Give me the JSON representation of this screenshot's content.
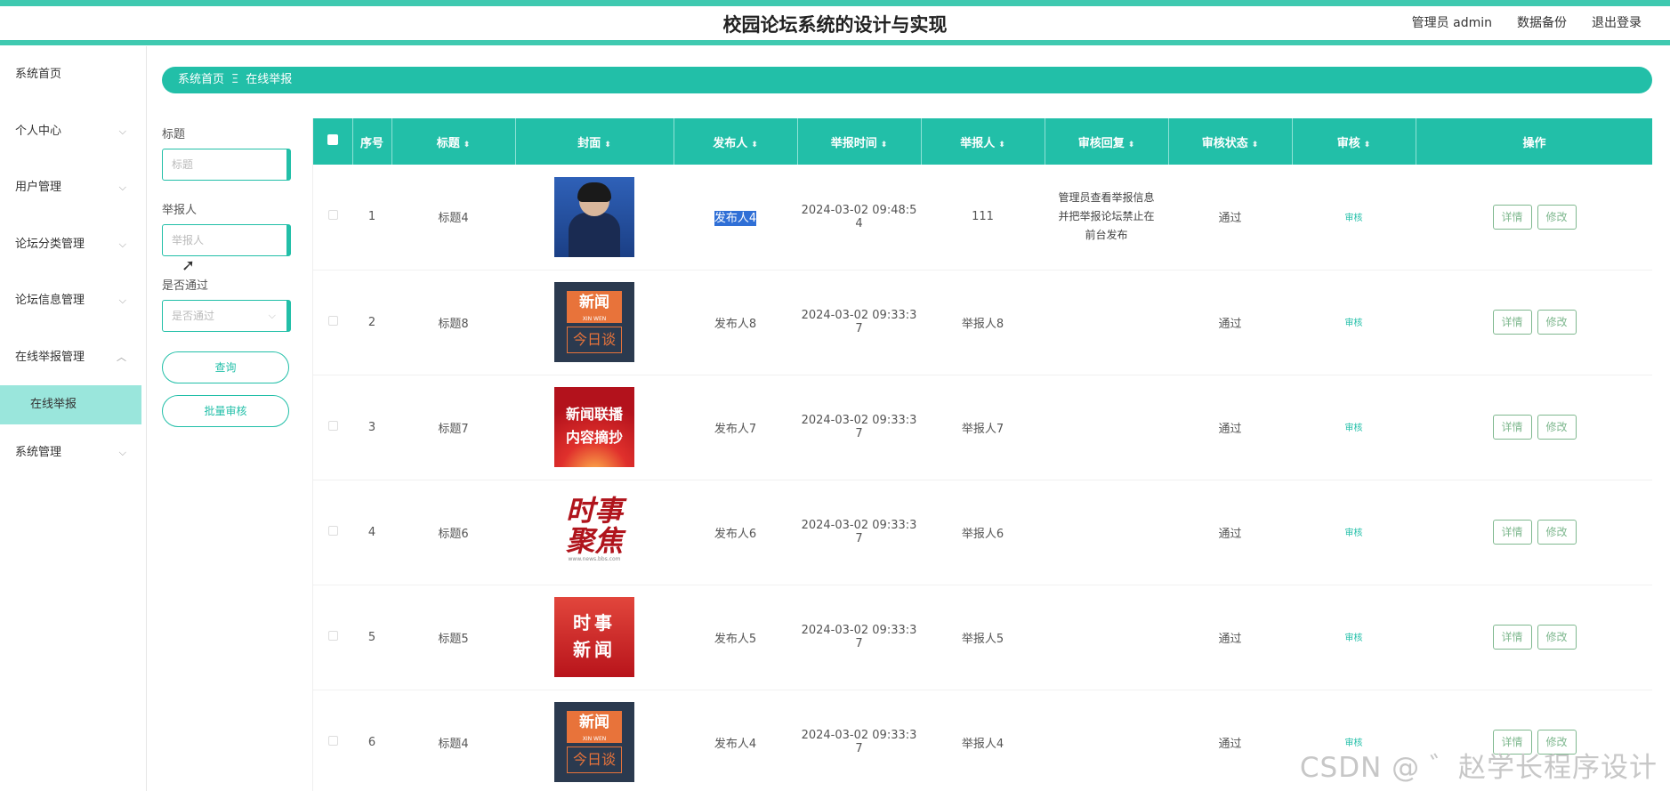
{
  "header": {
    "title": "校园论坛系统的设计与实现",
    "admin_label": "管理员 admin",
    "backup_label": "数据备份",
    "logout_label": "退出登录"
  },
  "sidebar": {
    "items": [
      {
        "label": "系统首页"
      },
      {
        "label": "个人中心",
        "chev": "⌵"
      },
      {
        "label": "用户管理",
        "chev": "⌵"
      },
      {
        "label": "论坛分类管理",
        "chev": "⌵"
      },
      {
        "label": "论坛信息管理",
        "chev": "⌵"
      },
      {
        "label": "在线举报管理",
        "chev": "︿"
      },
      {
        "label": "系统管理",
        "chev": "⌵"
      }
    ],
    "active_sub": "在线举报"
  },
  "breadcrumb": {
    "home": "系统首页",
    "sep": "Ξ",
    "current": "在线举报"
  },
  "filter": {
    "title_label": "标题",
    "title_placeholder": "标题",
    "reporter_label": "举报人",
    "reporter_placeholder": "举报人",
    "passed_label": "是否通过",
    "passed_placeholder": "是否通过",
    "query_button": "查询",
    "batch_button": "批量审核"
  },
  "table": {
    "headers": {
      "index": "序号",
      "title": "标题",
      "cover": "封面",
      "publisher": "发布人",
      "report_time": "举报时间",
      "reporter": "举报人",
      "reply": "审核回复",
      "status": "审核状态",
      "audit": "审核",
      "ops": "操作"
    },
    "sort_icon": "⬍",
    "audit_label": "审核",
    "detail_label": "详情",
    "edit_label": "修改",
    "rows": [
      {
        "index": "1",
        "title": "标题4",
        "cover": "news1",
        "publisher": "发布人4",
        "time1": "2024-03-02 09:48:5",
        "time2": "4",
        "reporter": "111",
        "reply": "管理员查看举报信息并把举报论坛禁止在前台发布",
        "status": "通过"
      },
      {
        "index": "2",
        "title": "标题8",
        "cover": "xinwen",
        "publisher": "发布人8",
        "time1": "2024-03-02 09:33:3",
        "time2": "7",
        "reporter": "举报人8",
        "reply": "",
        "status": "通过"
      },
      {
        "index": "3",
        "title": "标题7",
        "cover": "lianbo",
        "publisher": "发布人7",
        "time1": "2024-03-02 09:33:3",
        "time2": "7",
        "reporter": "举报人7",
        "reply": "",
        "status": "通过"
      },
      {
        "index": "4",
        "title": "标题6",
        "cover": "shishi1",
        "publisher": "发布人6",
        "time1": "2024-03-02 09:33:3",
        "time2": "7",
        "reporter": "举报人6",
        "reply": "",
        "status": "通过"
      },
      {
        "index": "5",
        "title": "标题5",
        "cover": "shishi2",
        "publisher": "发布人5",
        "time1": "2024-03-02 09:33:3",
        "time2": "7",
        "reporter": "举报人5",
        "reply": "",
        "status": "通过"
      },
      {
        "index": "6",
        "title": "标题4",
        "cover": "xinwen",
        "publisher": "发布人4",
        "time1": "2024-03-02 09:33:3",
        "time2": "7",
        "reporter": "举报人4",
        "reply": "",
        "status": "通过"
      }
    ]
  },
  "covers": {
    "xinwen_top": "新闻",
    "xinwen_small": "XIN WEN",
    "xinwen_bottom": "今日谈",
    "lianbo_1": "新闻联播",
    "lianbo_2": "内容摘抄",
    "shishi1_1": "时事",
    "shishi1_2": "聚焦",
    "shishi1_small": "www.news.bbs.com",
    "shishi2_1": "时事",
    "shishi2_2": "新闻"
  },
  "watermark": "CSDN @ ゛赵学长程序设计",
  "colors": {
    "accent": "#22bfa8",
    "stripe": "#3fc9b0",
    "submenu_bg": "#9ae6dc"
  }
}
